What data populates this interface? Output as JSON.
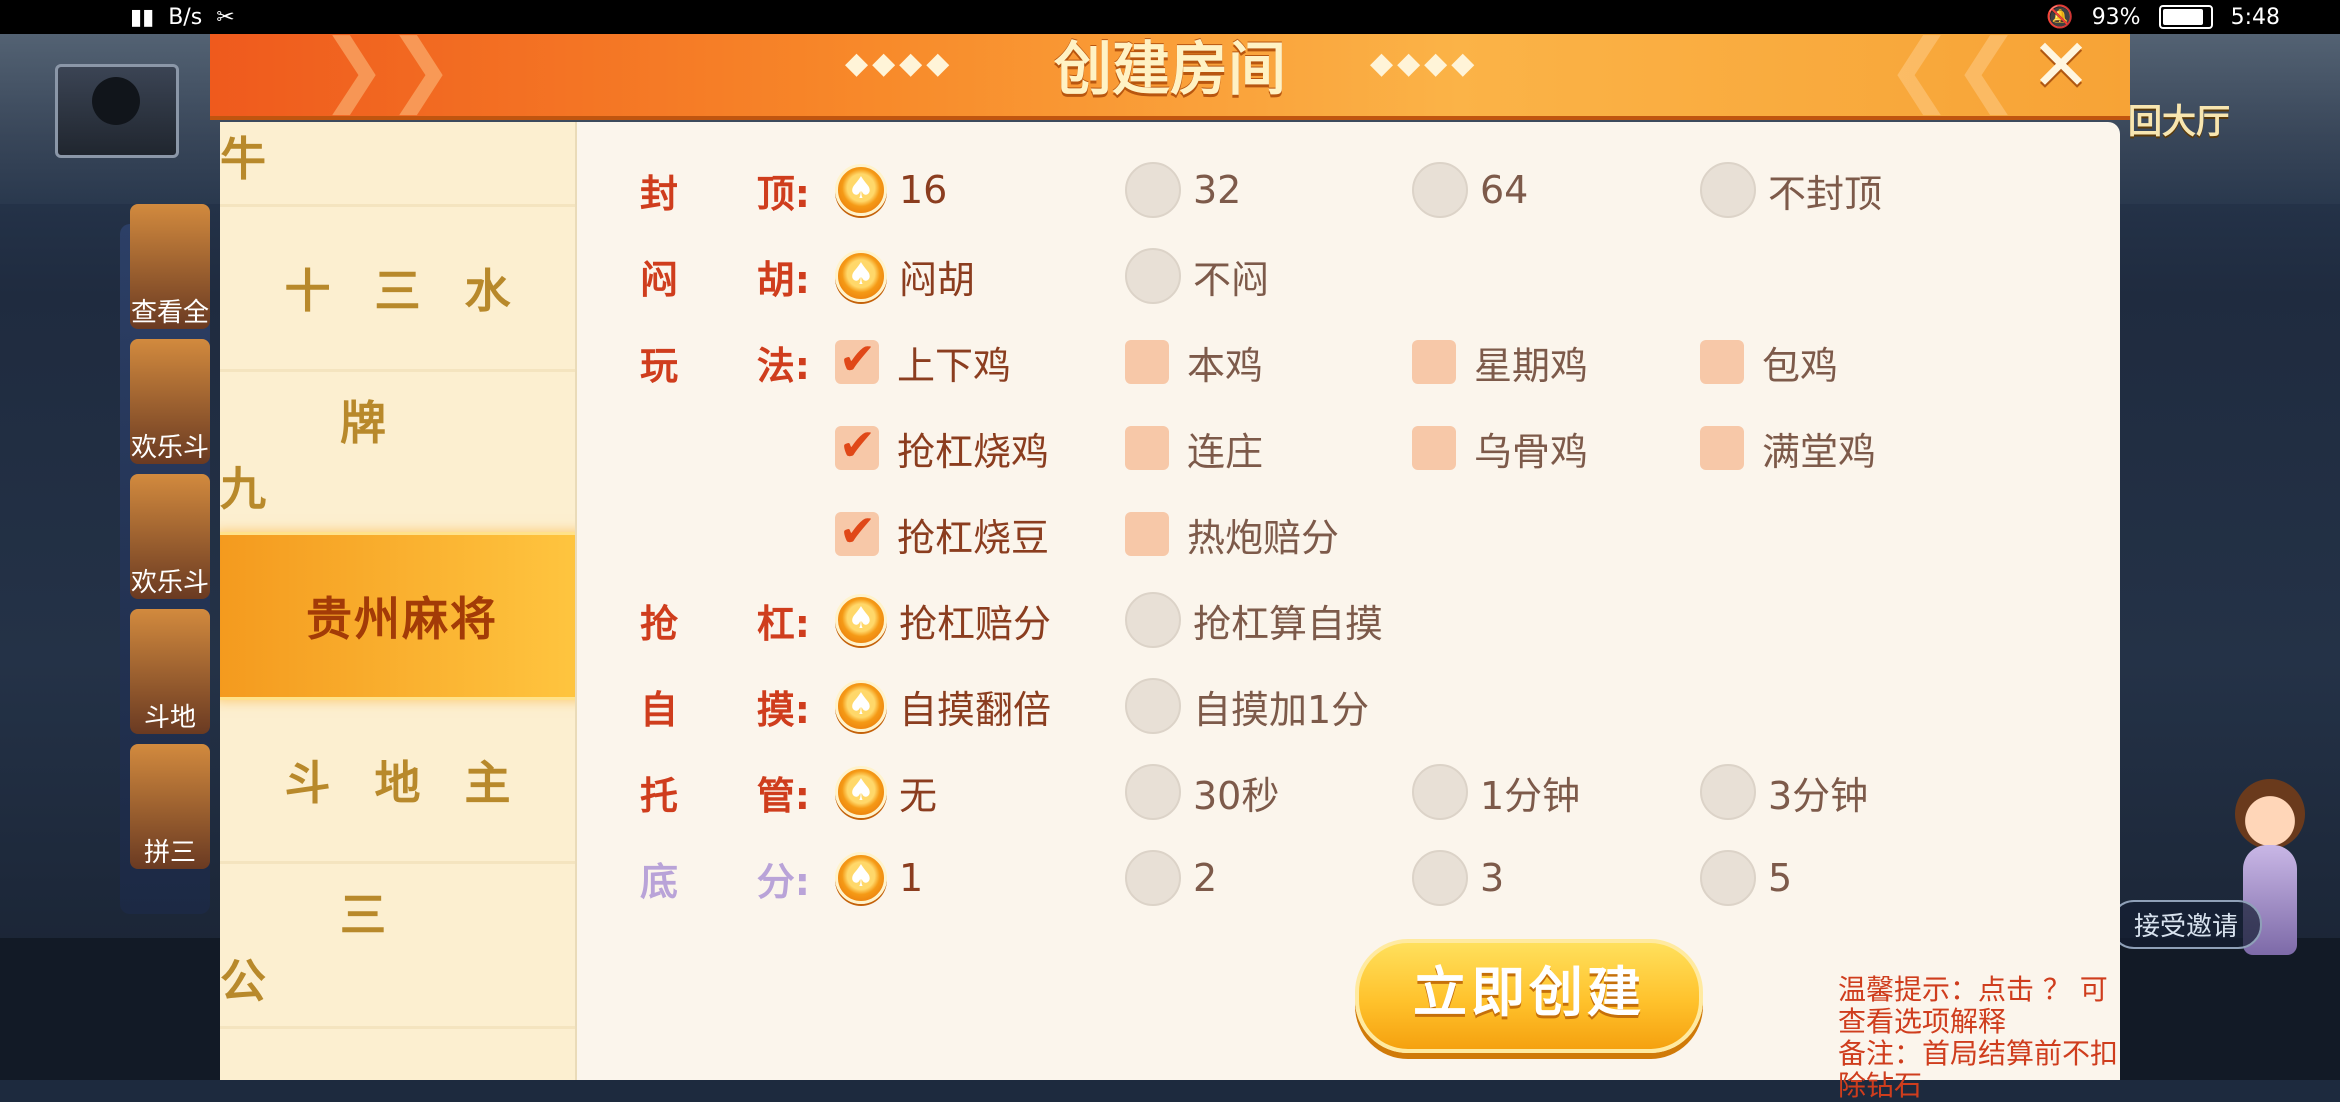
{
  "status_bar": {
    "net_speed": "B/s",
    "battery": "93%",
    "time": "5:48"
  },
  "lobby": {
    "back_hall": "回大厅",
    "side_games": [
      "查看全",
      "欢乐斗",
      "欢乐斗",
      "斗地",
      "拼三"
    ],
    "accept_invite": "接受邀请"
  },
  "dialog": {
    "title": "创建房间",
    "deco_left": "◆◆◆◆",
    "deco_right": "◆◆◆◆",
    "close": "✕",
    "categories": [
      "牛牛",
      "十三水",
      "牌九",
      "贵州麻将",
      "斗地主",
      "三公"
    ],
    "rows": [
      {
        "label": [
          "封",
          "顶:"
        ],
        "type": "radio",
        "options": [
          {
            "text": "16",
            "on": true
          },
          {
            "text": "32",
            "on": false
          },
          {
            "text": "64",
            "on": false
          },
          {
            "text": "不封顶",
            "on": false
          }
        ]
      },
      {
        "label": [
          "闷",
          "胡:"
        ],
        "type": "radio",
        "options": [
          {
            "text": "闷胡",
            "on": true
          },
          {
            "text": "不闷",
            "on": false
          }
        ]
      },
      {
        "label": [
          "玩",
          "法:"
        ],
        "type": "check",
        "options": [
          {
            "text": "上下鸡",
            "on": true
          },
          {
            "text": "本鸡",
            "on": false
          },
          {
            "text": "星期鸡",
            "on": false
          },
          {
            "text": "包鸡",
            "on": false
          }
        ]
      },
      {
        "label": [
          "",
          ""
        ],
        "type": "check",
        "options": [
          {
            "text": "抢杠烧鸡",
            "on": true
          },
          {
            "text": "连庄",
            "on": false
          },
          {
            "text": "乌骨鸡",
            "on": false
          },
          {
            "text": "满堂鸡",
            "on": false
          }
        ]
      },
      {
        "label": [
          "",
          ""
        ],
        "type": "check",
        "options": [
          {
            "text": "抢杠烧豆",
            "on": true
          },
          {
            "text": "热炮赔分",
            "on": false
          }
        ]
      },
      {
        "label": [
          "抢",
          "杠:"
        ],
        "type": "radio",
        "options": [
          {
            "text": "抢杠赔分",
            "on": true
          },
          {
            "text": "抢杠算自摸",
            "on": false
          }
        ]
      },
      {
        "label": [
          "自",
          "摸:"
        ],
        "type": "radio",
        "options": [
          {
            "text": "自摸翻倍",
            "on": true
          },
          {
            "text": "自摸加1分",
            "on": false
          }
        ]
      },
      {
        "label": [
          "托",
          "管:"
        ],
        "type": "radio",
        "options": [
          {
            "text": "无",
            "on": true
          },
          {
            "text": "30秒",
            "on": false
          },
          {
            "text": "1分钟",
            "on": false
          },
          {
            "text": "3分钟",
            "on": false
          }
        ]
      },
      {
        "label": [
          "底",
          "分:"
        ],
        "type": "radio",
        "faded": true,
        "options": [
          {
            "text": "1",
            "on": true
          },
          {
            "text": "2",
            "on": false
          },
          {
            "text": "3",
            "on": false
          },
          {
            "text": "5",
            "on": false
          }
        ]
      }
    ],
    "create_button": "立即创建",
    "tip_line1": "温馨提示：点击 ？ 可查看选项解释",
    "tip_line2": "备注：首局结算前不扣除钻石"
  }
}
